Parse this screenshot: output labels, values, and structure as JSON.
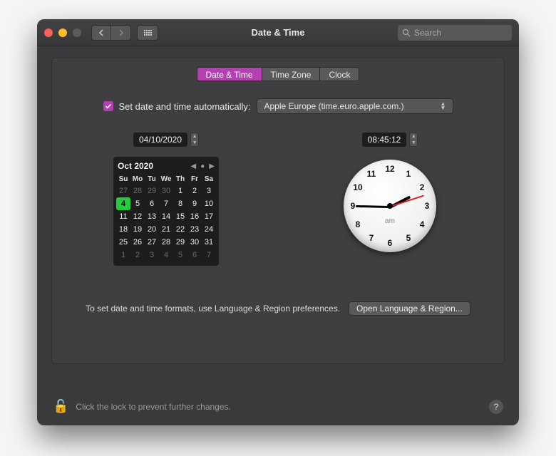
{
  "window": {
    "title": "Date & Time"
  },
  "search": {
    "placeholder": "Search"
  },
  "tabs": [
    {
      "label": "Date & Time",
      "active": true
    },
    {
      "label": "Time Zone",
      "active": false
    },
    {
      "label": "Clock",
      "active": false
    }
  ],
  "auto": {
    "checked": true,
    "label": "Set date and time automatically:",
    "server": "Apple Europe (time.euro.apple.com.)"
  },
  "date": {
    "value": "04/10/2020",
    "month_label": "Oct 2020",
    "dow": [
      "Su",
      "Mo",
      "Tu",
      "We",
      "Th",
      "Fr",
      "Sa"
    ],
    "weeks": [
      [
        {
          "n": "27",
          "dim": true
        },
        {
          "n": "28",
          "dim": true
        },
        {
          "n": "29",
          "dim": true
        },
        {
          "n": "30",
          "dim": true
        },
        {
          "n": "1"
        },
        {
          "n": "2"
        },
        {
          "n": "3"
        }
      ],
      [
        {
          "n": "4",
          "sel": true
        },
        {
          "n": "5"
        },
        {
          "n": "6"
        },
        {
          "n": "7"
        },
        {
          "n": "8"
        },
        {
          "n": "9"
        },
        {
          "n": "10"
        }
      ],
      [
        {
          "n": "11"
        },
        {
          "n": "12"
        },
        {
          "n": "13"
        },
        {
          "n": "14"
        },
        {
          "n": "15"
        },
        {
          "n": "16"
        },
        {
          "n": "17"
        }
      ],
      [
        {
          "n": "18"
        },
        {
          "n": "19"
        },
        {
          "n": "20"
        },
        {
          "n": "21"
        },
        {
          "n": "22"
        },
        {
          "n": "23"
        },
        {
          "n": "24"
        }
      ],
      [
        {
          "n": "25"
        },
        {
          "n": "26"
        },
        {
          "n": "27"
        },
        {
          "n": "28"
        },
        {
          "n": "29"
        },
        {
          "n": "30"
        },
        {
          "n": "31"
        }
      ],
      [
        {
          "n": "1",
          "dim": true
        },
        {
          "n": "2",
          "dim": true
        },
        {
          "n": "3",
          "dim": true
        },
        {
          "n": "4",
          "dim": true
        },
        {
          "n": "5",
          "dim": true
        },
        {
          "n": "6",
          "dim": true
        },
        {
          "n": "7",
          "dim": true
        }
      ]
    ]
  },
  "time": {
    "value": "08:45:12",
    "ampm": "am",
    "hour_angle": -27.4,
    "min_angle": 181.2,
    "sec_angle": -18,
    "numbers": [
      "12",
      "1",
      "2",
      "3",
      "4",
      "5",
      "6",
      "7",
      "8",
      "9",
      "10",
      "11"
    ]
  },
  "hint": {
    "text": "To set date and time formats, use Language & Region preferences.",
    "button": "Open Language & Region..."
  },
  "lock": {
    "text": "Click the lock to prevent further changes."
  }
}
